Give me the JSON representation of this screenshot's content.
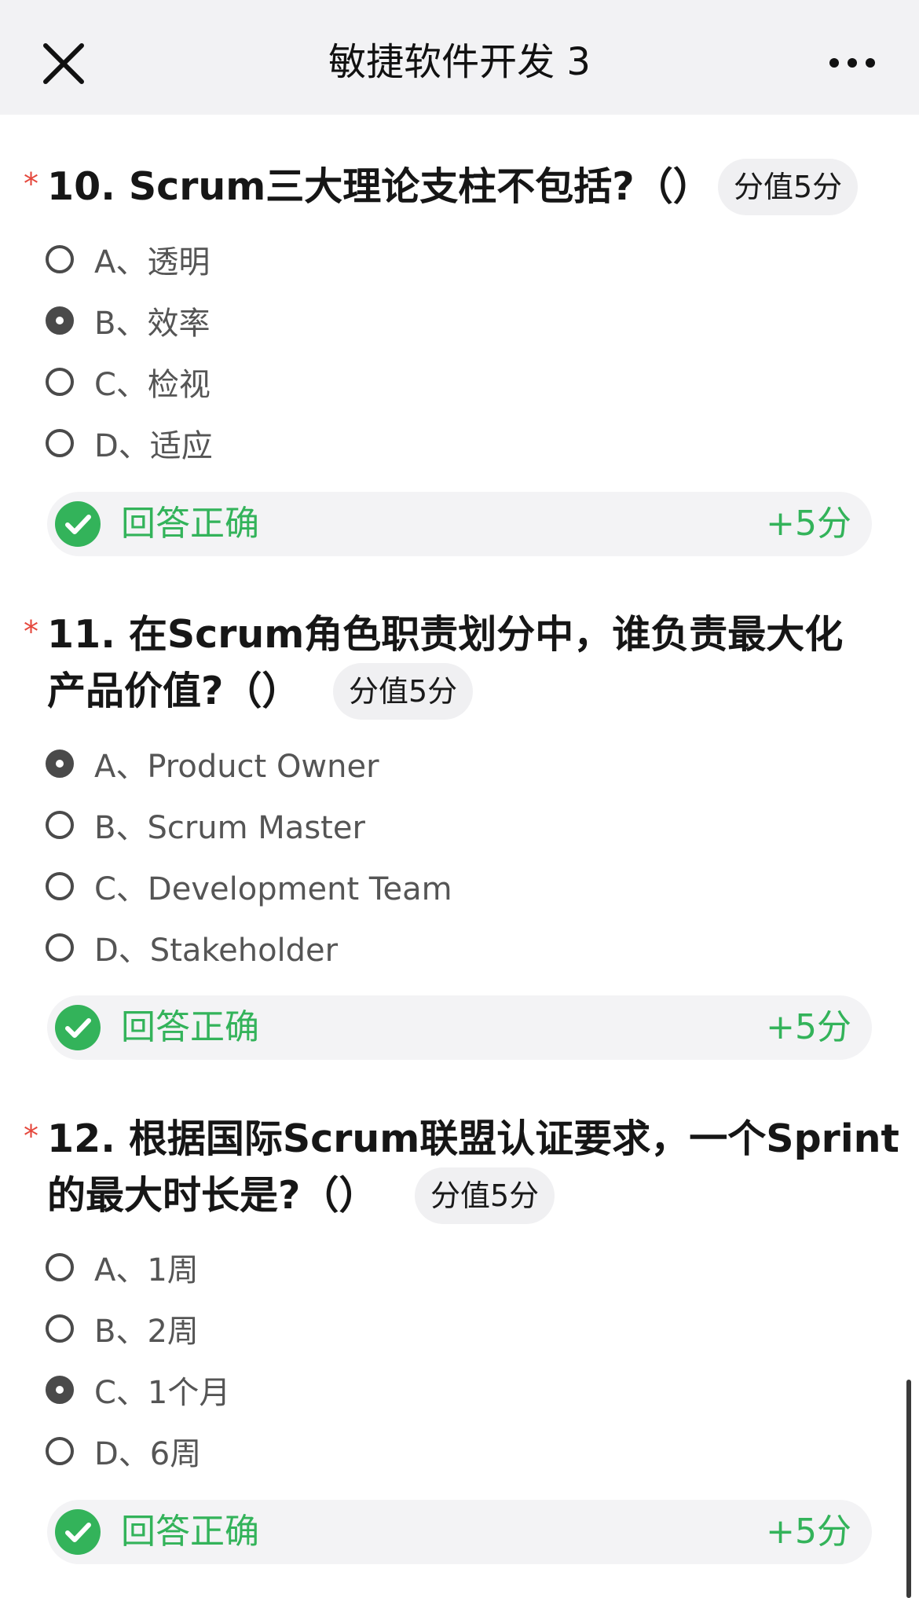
{
  "nav": {
    "title": "敏捷软件开发 3",
    "close_icon": "close-icon",
    "more_icon": "more-horizontal-icon"
  },
  "colors": {
    "required_star": "#e5483d",
    "correct_green": "#33b35a",
    "nav_bg": "#f2f2f4"
  },
  "questions": [
    {
      "star": "*",
      "lines": [
        "10. Scrum三大理论支柱不包括?（）"
      ],
      "score_label": "分值5分",
      "options": [
        {
          "label": "A、透明",
          "selected": false
        },
        {
          "label": "B、效率",
          "selected": true
        },
        {
          "label": "C、检视",
          "selected": false
        },
        {
          "label": "D、适应",
          "selected": false
        }
      ],
      "result": {
        "text": "回答正确",
        "score": "+5分"
      }
    },
    {
      "star": "*",
      "lines": [
        "11. 在Scrum角色职责划分中，谁负责最大化",
        "产品价值?（）"
      ],
      "score_label": "分值5分",
      "options": [
        {
          "label": "A、Product Owner",
          "selected": true
        },
        {
          "label": "B、Scrum Master",
          "selected": false
        },
        {
          "label": "C、Development Team",
          "selected": false
        },
        {
          "label": "D、Stakeholder",
          "selected": false
        }
      ],
      "result": {
        "text": "回答正确",
        "score": "+5分"
      }
    },
    {
      "star": "*",
      "lines": [
        "12. 根据国际Scrum联盟认证要求，一个Sprint",
        "的最大时长是?（）"
      ],
      "score_label": "分值5分",
      "options": [
        {
          "label": "A、1周",
          "selected": false
        },
        {
          "label": "B、2周",
          "selected": false
        },
        {
          "label": "C、1个月",
          "selected": true
        },
        {
          "label": "D、6周",
          "selected": false
        }
      ],
      "result": {
        "text": "回答正确",
        "score": "+5分"
      }
    }
  ]
}
